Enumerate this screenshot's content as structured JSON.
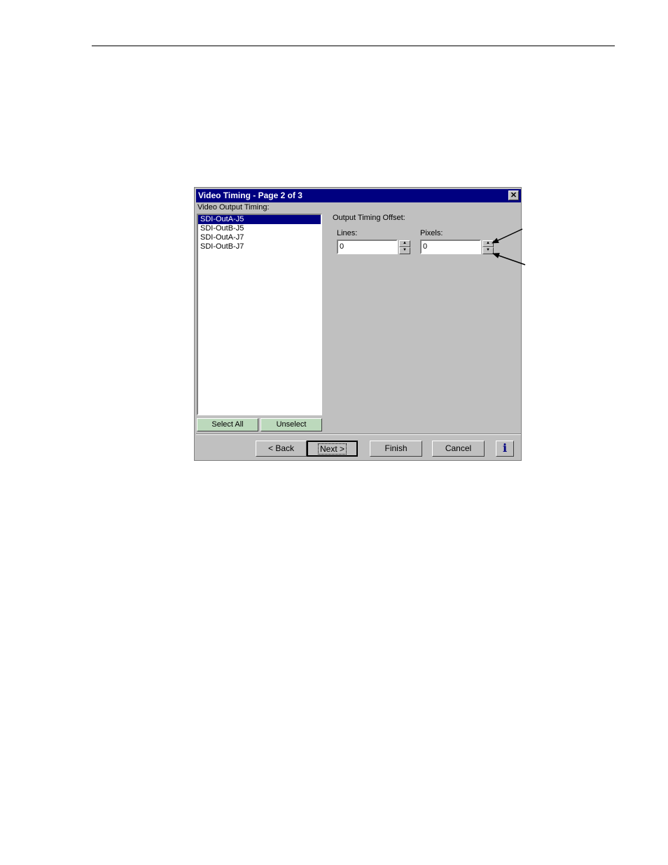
{
  "dialog": {
    "title": "Video Timing - Page 2 of 3",
    "close_glyph": "✕",
    "list_label": "Video Output Timing:",
    "list_items": [
      "SDI-OutA-J5",
      "SDI-OutB-J5",
      "SDI-OutA-J7",
      "SDI-OutB-J7"
    ],
    "selected_index": 0,
    "select_all_label": "Select All",
    "unselect_label": "Unselect",
    "offset_label": "Output Timing Offset:",
    "lines_label": "Lines:",
    "lines_value": "0",
    "pixels_label": "Pixels:",
    "pixels_value": "0",
    "back_label": "< Back",
    "next_label": "Next >",
    "finish_label": "Finish",
    "cancel_label": "Cancel",
    "info_label": "i"
  },
  "colors": {
    "titlebar": "#000080",
    "selection": "#000080",
    "dialog_bg": "#c0c0c0",
    "select_buttons_bg": "#bcd9bc",
    "info_glyph": "#000080"
  },
  "icons": {
    "spin_up": "spin-up-arrow-icon",
    "spin_down": "spin-down-arrow-icon",
    "callout": "callout-arrow-icon"
  }
}
